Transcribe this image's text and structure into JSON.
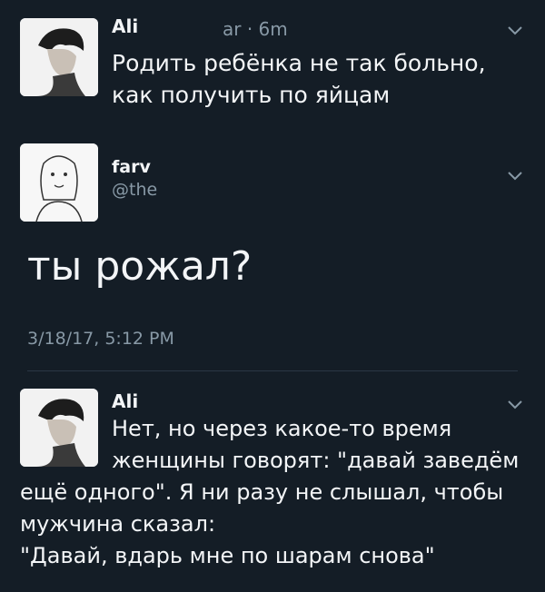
{
  "tweet1": {
    "author": "Ali",
    "meta_fragment": "ar · 6m",
    "text": "Родить ребёнка не так больно,\nкак получить по яйцам"
  },
  "main": {
    "author": "farv",
    "handle_fragment": "@the",
    "text": "ты рожал?",
    "timestamp": "3/18/17, 5:12 PM"
  },
  "reply": {
    "author": "Ali",
    "text_line1": "Нет, но через какое-то время",
    "text_line2": "женщины говорят: \"давай заведём",
    "text_rest": "ещё одного\". Я ни разу не слышал, чтобы\nмужчина сказал:\n\"Давай, вдарь мне по шарам снова\""
  },
  "icons": {
    "chevron": "chevron-down-icon",
    "avatar_ali": "user-avatar",
    "avatar_farv": "user-avatar"
  },
  "colors": {
    "background": "#141d26",
    "text": "#f3f5f7",
    "secondary_text": "#8899a6",
    "divider": "#2a3744"
  }
}
